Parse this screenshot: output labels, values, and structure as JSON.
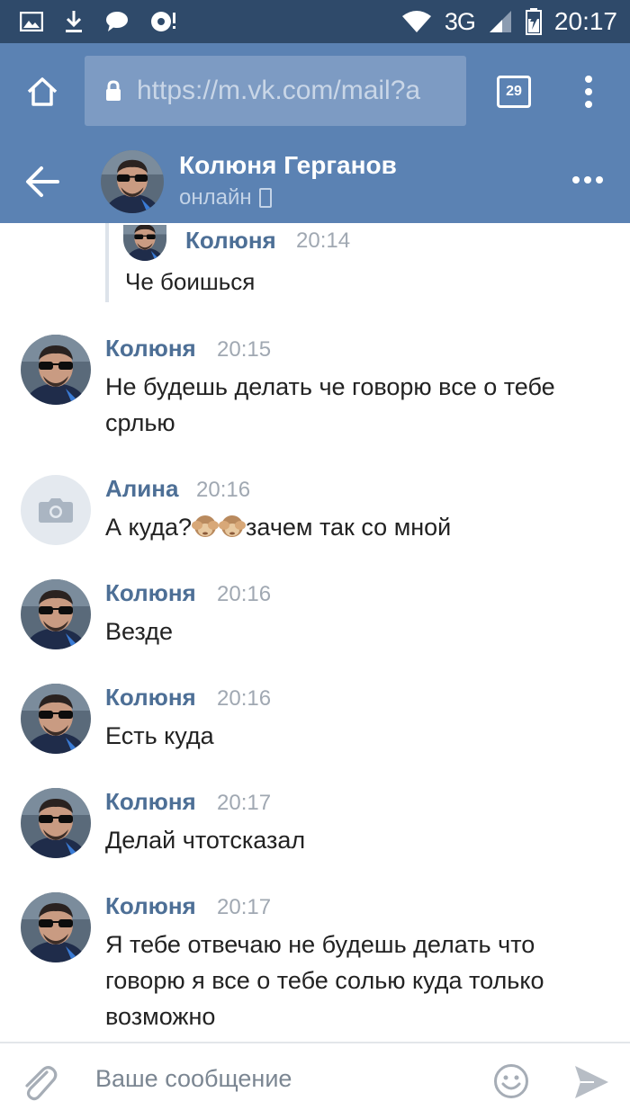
{
  "status_bar": {
    "network": "3G",
    "time": "20:17"
  },
  "browser": {
    "url": "https://m.vk.com/mail?a",
    "tabs_count": "29"
  },
  "chat": {
    "contact_name": "Колюня Герганов",
    "contact_status": "онлайн"
  },
  "quote": {
    "name": "Колюня",
    "time": "20:14",
    "text": "Че боишься"
  },
  "messages": [
    {
      "name": "Колюня",
      "time": "20:15",
      "text": "Не будешь делать че говорю все о тебе срлью"
    },
    {
      "name": "Алина",
      "time": "20:16",
      "text_before": "А куда?",
      "text_after": "зачем так со мной"
    },
    {
      "name": "Колюня",
      "time": "20:16",
      "text": "Везде"
    },
    {
      "name": "Колюня",
      "time": "20:16",
      "text": "Есть куда"
    },
    {
      "name": "Колюня",
      "time": "20:17",
      "text": "Делай чтотсказал"
    },
    {
      "name": "Колюня",
      "time": "20:17",
      "text": "Я тебе отвечаю не будешь делать что говорю я все о тебе солью куда только возможно"
    }
  ],
  "compose": {
    "placeholder": "Ваше сообщение"
  },
  "colors": {
    "status_bar": "#2f4a6a",
    "header": "#5b82b3",
    "name": "#4d6f96"
  }
}
